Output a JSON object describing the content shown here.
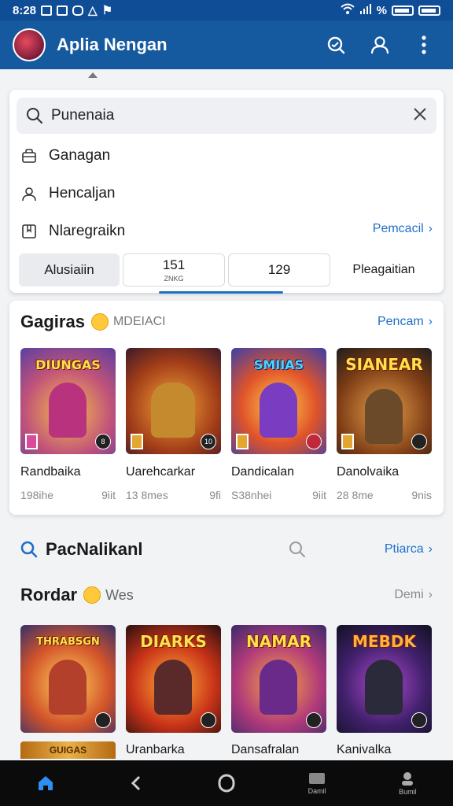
{
  "status_bar": {
    "time": "8:28",
    "battery_text": "%"
  },
  "app_bar": {
    "title": "Aplia Nengan"
  },
  "search": {
    "value": "Punenaia",
    "suggestions": [
      {
        "label": "Ganagan",
        "icon": "bag-icon"
      },
      {
        "label": "Hencaljan",
        "icon": "person-icon"
      },
      {
        "label": "Nlaregraikn",
        "icon": "bookmark-icon"
      }
    ],
    "link": "Pemcacil"
  },
  "tabs": [
    {
      "label": "Alusiaiin",
      "sub": ""
    },
    {
      "label": "151",
      "sub": "ZNKG"
    },
    {
      "label": "129",
      "sub": ""
    },
    {
      "label": "Pleagaitian",
      "sub": ""
    }
  ],
  "section1": {
    "title": "Gagiras",
    "subtitle": "MDEIACI",
    "more": "Pencam",
    "games": [
      {
        "name": "Randbaika",
        "size": "198ihe",
        "count": "9iit",
        "banner": "DIUNGAS",
        "badge": "8"
      },
      {
        "name": "Uarehcarkar",
        "size": "13 8mes",
        "count": "9fi",
        "banner": "",
        "badge": "10"
      },
      {
        "name": "Dandicalan",
        "size": "S38nhei",
        "count": "9iit",
        "banner": "SMIIAS",
        "badge": ""
      },
      {
        "name": "Danolvaika",
        "size": "28 8me",
        "count": "9nis",
        "banner": "SIANEAR",
        "badge": ""
      }
    ]
  },
  "section2": {
    "title": "PacNalikanl",
    "more": "Ptiarca"
  },
  "section3": {
    "title": "Rordar",
    "subtitle": "Wes",
    "more": "Demi",
    "games": [
      {
        "banner": "THRABSGN",
        "badge": ""
      },
      {
        "banner": "DIARKS",
        "badge": ""
      },
      {
        "banner": "NAMAR",
        "badge": ""
      },
      {
        "banner": "MEBDK",
        "badge": ""
      }
    ],
    "strip_text": "GUIGAS",
    "names": [
      "Uranbarka",
      "Dansafralan",
      "Kanivalka"
    ]
  },
  "nav": [
    {
      "label": "",
      "icon": "home-icon"
    },
    {
      "label": "",
      "icon": "back-icon"
    },
    {
      "label": "",
      "icon": "circle-icon"
    },
    {
      "label": "Damil",
      "icon": "library-icon"
    },
    {
      "label": "Bumil",
      "icon": "profile-icon"
    }
  ],
  "colors": {
    "status_bar": "#0f4d97",
    "app_bar": "#15599f",
    "accent": "#1f6fc9",
    "nav_bg": "#0b0b0c"
  }
}
